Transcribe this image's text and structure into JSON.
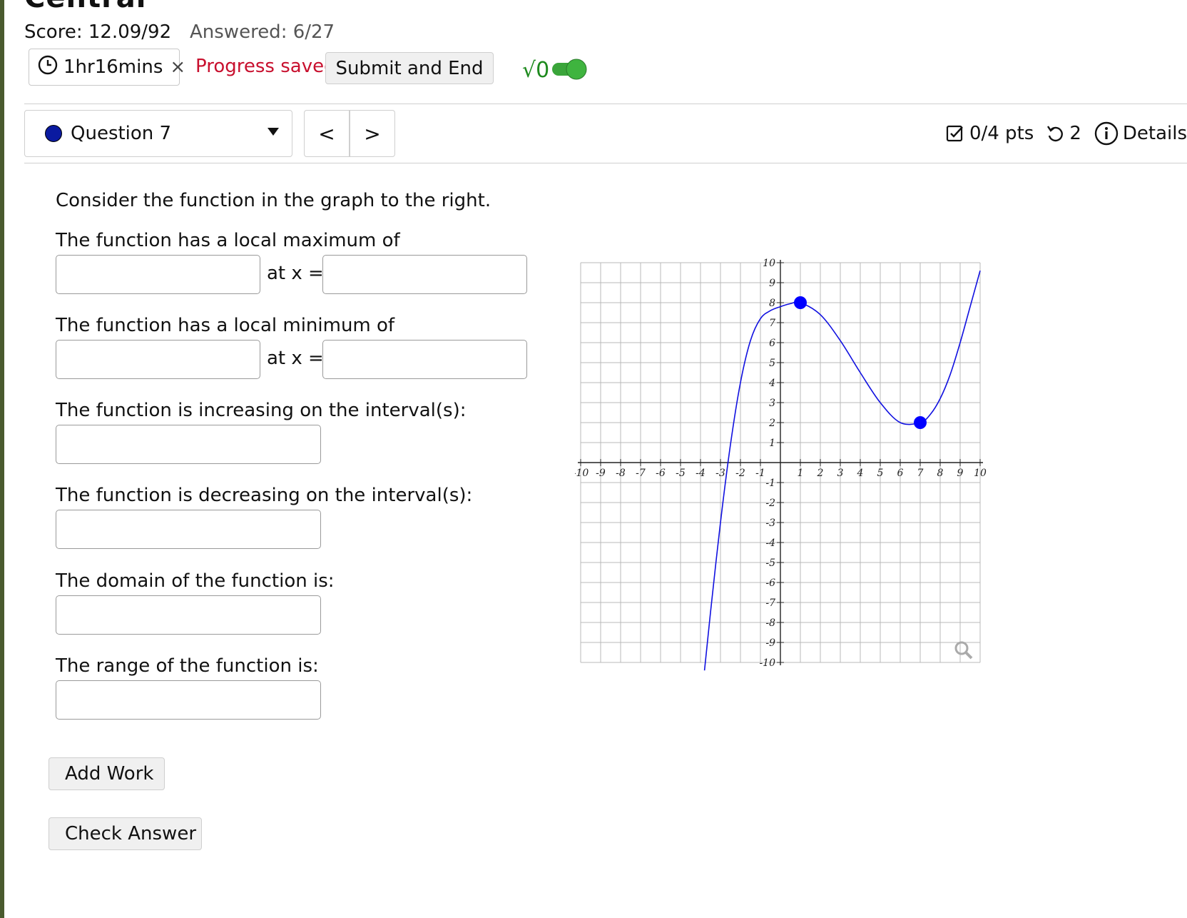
{
  "header": {
    "course_title": "Central",
    "score": "Score: 12.09/92",
    "answered": "Answered: 6/27",
    "timer": "1hr16mins",
    "timer_close": "×",
    "progress": "Progress saved",
    "submit_label": "Submit and End",
    "sqrt_label": "√0"
  },
  "question_nav": {
    "selected": "Question 7",
    "prev": "<",
    "next": ">"
  },
  "meta": {
    "points": "0/4 pts",
    "attempts": "2",
    "details": "Details"
  },
  "question": {
    "intro": "Consider the function in the graph to the right.",
    "max_prompt": "The function has a local maximum of",
    "min_prompt": "The function has a local minimum of",
    "at_x": "at x =",
    "increasing_prompt": "The function is increasing on the interval(s):",
    "decreasing_prompt": "The function is decreasing on the interval(s):",
    "domain_prompt": "The domain of the function is:",
    "range_prompt": "The range of the function is:"
  },
  "buttons": {
    "add_work": "Add Work",
    "check_answer": "Check Answer"
  },
  "chart_data": {
    "type": "line",
    "xlim": [
      -10,
      10
    ],
    "ylim": [
      -10,
      10
    ],
    "grid": true,
    "x_ticks": [
      -10,
      -9,
      -8,
      -7,
      -6,
      -5,
      -4,
      -3,
      -2,
      -1,
      1,
      2,
      3,
      4,
      5,
      6,
      7,
      8,
      9,
      10
    ],
    "y_ticks": [
      -10,
      -9,
      -8,
      -7,
      -6,
      -5,
      -4,
      -3,
      -2,
      -1,
      1,
      2,
      3,
      4,
      5,
      6,
      7,
      8,
      9,
      10
    ],
    "series": [
      {
        "x": [
          -3.8,
          -3.5,
          -3,
          -2.5,
          -2,
          -1.5,
          -1,
          -0.5,
          0,
          0.5,
          1,
          2,
          3,
          4,
          5,
          6,
          7,
          7.5,
          8,
          8.5,
          9,
          9.5,
          10
        ],
        "y": [
          -10.4,
          -7.5,
          -3.0,
          0.9,
          4.0,
          6.1,
          7.2,
          7.6,
          7.8,
          7.95,
          8,
          7.4,
          6.1,
          4.5,
          3.0,
          2.0,
          2.0,
          2.4,
          3.2,
          4.4,
          6.0,
          7.8,
          9.6
        ]
      }
    ],
    "points": [
      {
        "x": 1,
        "y": 8
      },
      {
        "x": 7,
        "y": 2
      }
    ],
    "colors": {
      "curve": "#1010e0",
      "points": "#0000ff"
    }
  }
}
